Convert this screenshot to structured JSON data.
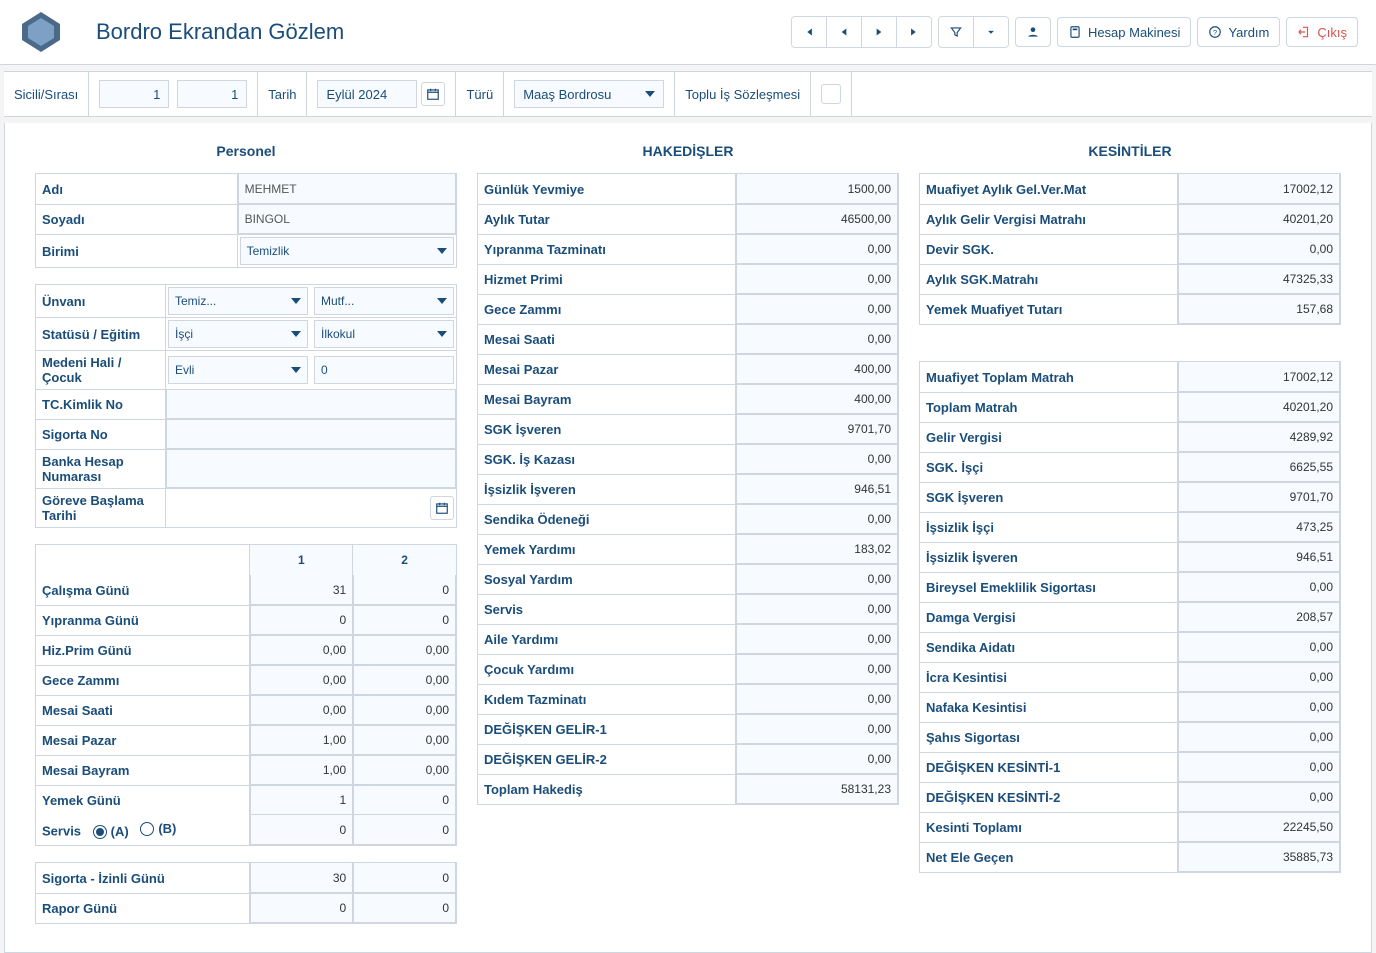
{
  "header": {
    "title": "Bordro Ekrandan Gözlem",
    "hesap_btn": "Hesap Makinesi",
    "yardim_btn": "Yardım",
    "cikis_btn": "Çıkış"
  },
  "filter": {
    "sicil_label": "Sicili/Sırası",
    "sicil_v1": "1",
    "sicil_v2": "1",
    "tarih_label": "Tarih",
    "tarih_val": "Eylül 2024",
    "turu_label": "Türü",
    "turu_val": "Maaş Bordrosu",
    "tis_label": "Toplu İş Sözleşmesi"
  },
  "personel": {
    "title": "Personel",
    "adi_l": "Adı",
    "adi_v": "MEHMET",
    "soyadi_l": "Soyadı",
    "soyadi_v": "BINGOL",
    "birimi_l": "Birimi",
    "birimi_v": "Temizlik",
    "unvani_l": "Ünvanı",
    "unvani_v1": "Temiz...",
    "unvani_v2": "Mutf...",
    "statu_l": "Statüsü / Eğitim",
    "statu_v1": "İşçi",
    "statu_v2": "İlkokul",
    "medeni_l": "Medeni Hali / Çocuk",
    "medeni_v1": "Evli",
    "medeni_v2": "0",
    "tc_l": "TC.Kimlik No",
    "sigorta_l": "Sigorta No",
    "banka_l": "Banka Hesap Numarası",
    "gorev_l": "Göreve Başlama Tarihi"
  },
  "days": {
    "h1": "1",
    "h2": "2",
    "rows": [
      {
        "l": "Çalışma Günü",
        "v1": "31",
        "v2": "0"
      },
      {
        "l": "Yıpranma Günü",
        "v1": "0",
        "v2": "0"
      },
      {
        "l": "Hiz.Prim Günü",
        "v1": "0,00",
        "v2": "0,00"
      },
      {
        "l": "Gece Zammı",
        "v1": "0,00",
        "v2": "0,00"
      },
      {
        "l": "Mesai Saati",
        "v1": "0,00",
        "v2": "0,00"
      },
      {
        "l": "Mesai Pazar",
        "v1": "1,00",
        "v2": "0,00"
      },
      {
        "l": "Mesai Bayram",
        "v1": "1,00",
        "v2": "0,00"
      },
      {
        "l": "Yemek Günü",
        "v1": "1",
        "v2": "0"
      }
    ],
    "servis_l": "Servis",
    "servis_a": "(A)",
    "servis_b": "(B)",
    "servis_v1": "0",
    "servis_v2": "0",
    "sigorta_izin_l": "Sigorta - İzinli Günü",
    "sigorta_izin_v1": "30",
    "sigorta_izin_v2": "0",
    "rapor_l": "Rapor Günü",
    "rapor_v1": "0",
    "rapor_v2": "0"
  },
  "hak": {
    "title": "HAKEDİŞLER",
    "rows": [
      {
        "l": "Günlük Yevmiye",
        "v": "1500,00"
      },
      {
        "l": "Aylık Tutar",
        "v": "46500,00"
      },
      {
        "l": "Yıpranma Tazminatı",
        "v": "0,00"
      },
      {
        "l": "Hizmet Primi",
        "v": "0,00"
      },
      {
        "l": "Gece Zammı",
        "v": "0,00"
      },
      {
        "l": "Mesai Saati",
        "v": "0,00"
      },
      {
        "l": "Mesai Pazar",
        "v": "400,00"
      },
      {
        "l": "Mesai Bayram",
        "v": "400,00"
      },
      {
        "l": "SGK İşveren",
        "v": "9701,70"
      },
      {
        "l": "SGK. İş Kazası",
        "v": "0,00"
      },
      {
        "l": "İşsizlik İşveren",
        "v": "946,51"
      },
      {
        "l": "Sendika Ödeneği",
        "v": "0,00"
      },
      {
        "l": "Yemek Yardımı",
        "v": "183,02"
      },
      {
        "l": "Sosyal Yardım",
        "v": "0,00"
      },
      {
        "l": "Servis",
        "v": "0,00"
      },
      {
        "l": "Aile Yardımı",
        "v": "0,00"
      },
      {
        "l": "Çocuk Yardımı",
        "v": "0,00"
      },
      {
        "l": "Kıdem Tazminatı",
        "v": "0,00"
      },
      {
        "l": "DEĞİŞKEN GELİR-1",
        "v": "0,00"
      },
      {
        "l": "DEĞİŞKEN GELİR-2",
        "v": "0,00"
      },
      {
        "l": "Toplam Hakediş",
        "v": "58131,23"
      }
    ]
  },
  "kes": {
    "title": "KESİNTİLER",
    "g1": [
      {
        "l": "Muafiyet Aylık Gel.Ver.Mat",
        "v": "17002,12"
      },
      {
        "l": "Aylık Gelir Vergisi Matrahı",
        "v": "40201,20"
      },
      {
        "l": "Devir SGK.",
        "v": "0,00"
      },
      {
        "l": "Aylık SGK.Matrahı",
        "v": "47325,33"
      },
      {
        "l": "Yemek Muafiyet Tutarı",
        "v": "157,68"
      }
    ],
    "g2": [
      {
        "l": "Muafiyet Toplam Matrah",
        "v": "17002,12"
      },
      {
        "l": "Toplam Matrah",
        "v": "40201,20"
      },
      {
        "l": "Gelir Vergisi",
        "v": "4289,92"
      },
      {
        "l": "SGK. İşçi",
        "v": "6625,55"
      },
      {
        "l": "SGK İşveren",
        "v": "9701,70"
      },
      {
        "l": "İşsizlik İşçi",
        "v": "473,25"
      },
      {
        "l": "İşsizlik İşveren",
        "v": "946,51"
      },
      {
        "l": "Bireysel Emeklilik Sigortası",
        "v": "0,00"
      },
      {
        "l": "Damga Vergisi",
        "v": "208,57"
      },
      {
        "l": "Sendika Aidatı",
        "v": "0,00"
      },
      {
        "l": "İcra Kesintisi",
        "v": "0,00"
      },
      {
        "l": "Nafaka Kesintisi",
        "v": "0,00"
      },
      {
        "l": "Şahıs Sigortası",
        "v": "0,00"
      },
      {
        "l": "DEĞİŞKEN KESİNTİ-1",
        "v": "0,00"
      },
      {
        "l": "DEĞİŞKEN KESİNTİ-2",
        "v": "0,00"
      },
      {
        "l": "Kesinti Toplamı",
        "v": "22245,50"
      },
      {
        "l": "Net Ele Geçen",
        "v": "35885,73"
      }
    ]
  }
}
